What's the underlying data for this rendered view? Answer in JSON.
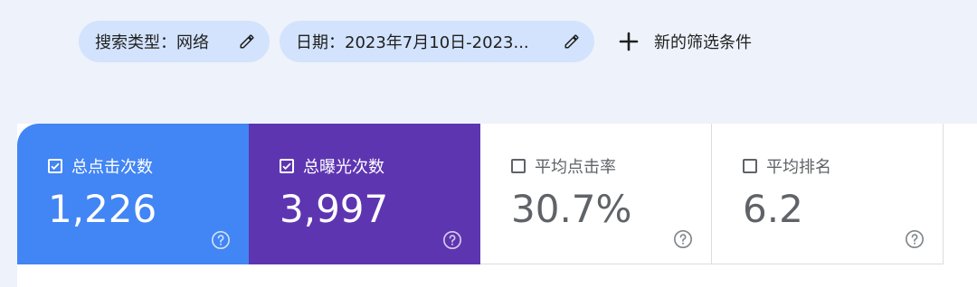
{
  "filters": {
    "search_type": "搜索类型：网络",
    "date": "日期：2023年7月10日-2023...",
    "add_filter": "新的筛选条件"
  },
  "metrics": [
    {
      "label": "总点击次数",
      "value": "1,226",
      "checked": true,
      "color": "#4285f4"
    },
    {
      "label": "总曝光次数",
      "value": "3,997",
      "checked": true,
      "color": "#5e35b1"
    },
    {
      "label": "平均点击率",
      "value": "30.7%",
      "checked": false
    },
    {
      "label": "平均排名",
      "value": "6.2",
      "checked": false
    }
  ],
  "icons": {
    "edit": "pencil-icon",
    "add": "plus-icon",
    "help": "help-circle-icon",
    "checkbox": "checkbox-icon"
  }
}
